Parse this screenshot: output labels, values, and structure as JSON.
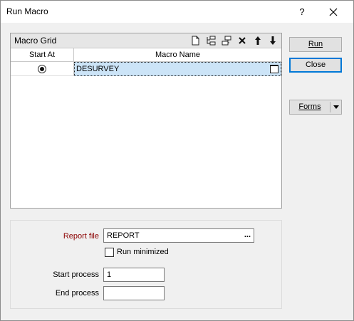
{
  "window": {
    "title": "Run Macro",
    "help_label": "?"
  },
  "grid": {
    "title": "Macro Grid",
    "toolbar_icons": [
      "new-row-icon",
      "insert-row-icon",
      "insert-after-icon",
      "delete-icon",
      "move-up-icon",
      "move-down-icon"
    ],
    "columns": [
      "Start At",
      "Macro Name"
    ],
    "rows": [
      {
        "start_at_selected": true,
        "macro_name": "DESURVEY"
      }
    ]
  },
  "buttons": {
    "run_label": "Run",
    "close_label": "Close",
    "forms_label": "Forms"
  },
  "options": {
    "report_file_label": "Report file",
    "report_file_value": "REPORT",
    "browse_label": "...",
    "run_minimized_label": "Run minimized",
    "run_minimized_checked": false,
    "start_process_label": "Start process",
    "start_process_value": "1",
    "end_process_label": "End process",
    "end_process_value": ""
  },
  "colors": {
    "report_label": "#8b0000",
    "selection": "#cce4f7",
    "default_button_border": "#0078d7"
  }
}
